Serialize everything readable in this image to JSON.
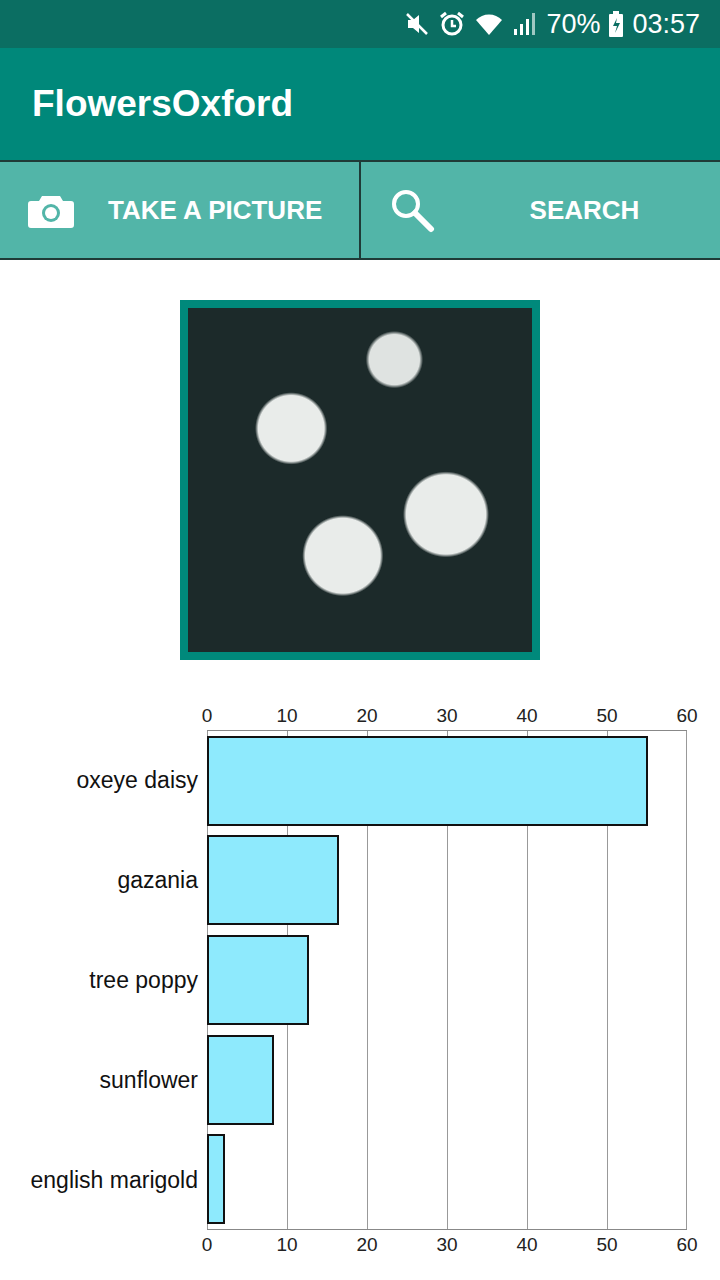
{
  "status_bar": {
    "battery": "70%",
    "time": "03:57"
  },
  "app_bar": {
    "title": "FlowersOxford"
  },
  "actions": [
    {
      "label": "TAKE A PICTURE",
      "icon": "camera"
    },
    {
      "label": "SEARCH",
      "icon": "search"
    }
  ],
  "chart": {
    "ticks": [
      "0",
      "10",
      "20",
      "30",
      "40",
      "50",
      "60"
    ],
    "max": 60,
    "categories": [
      "oxeye daisy",
      "gazania",
      "tree poppy",
      "sunflower",
      "english marigold"
    ],
    "values": [
      55.1,
      16.5,
      12.75,
      8.4,
      2.2
    ]
  }
}
